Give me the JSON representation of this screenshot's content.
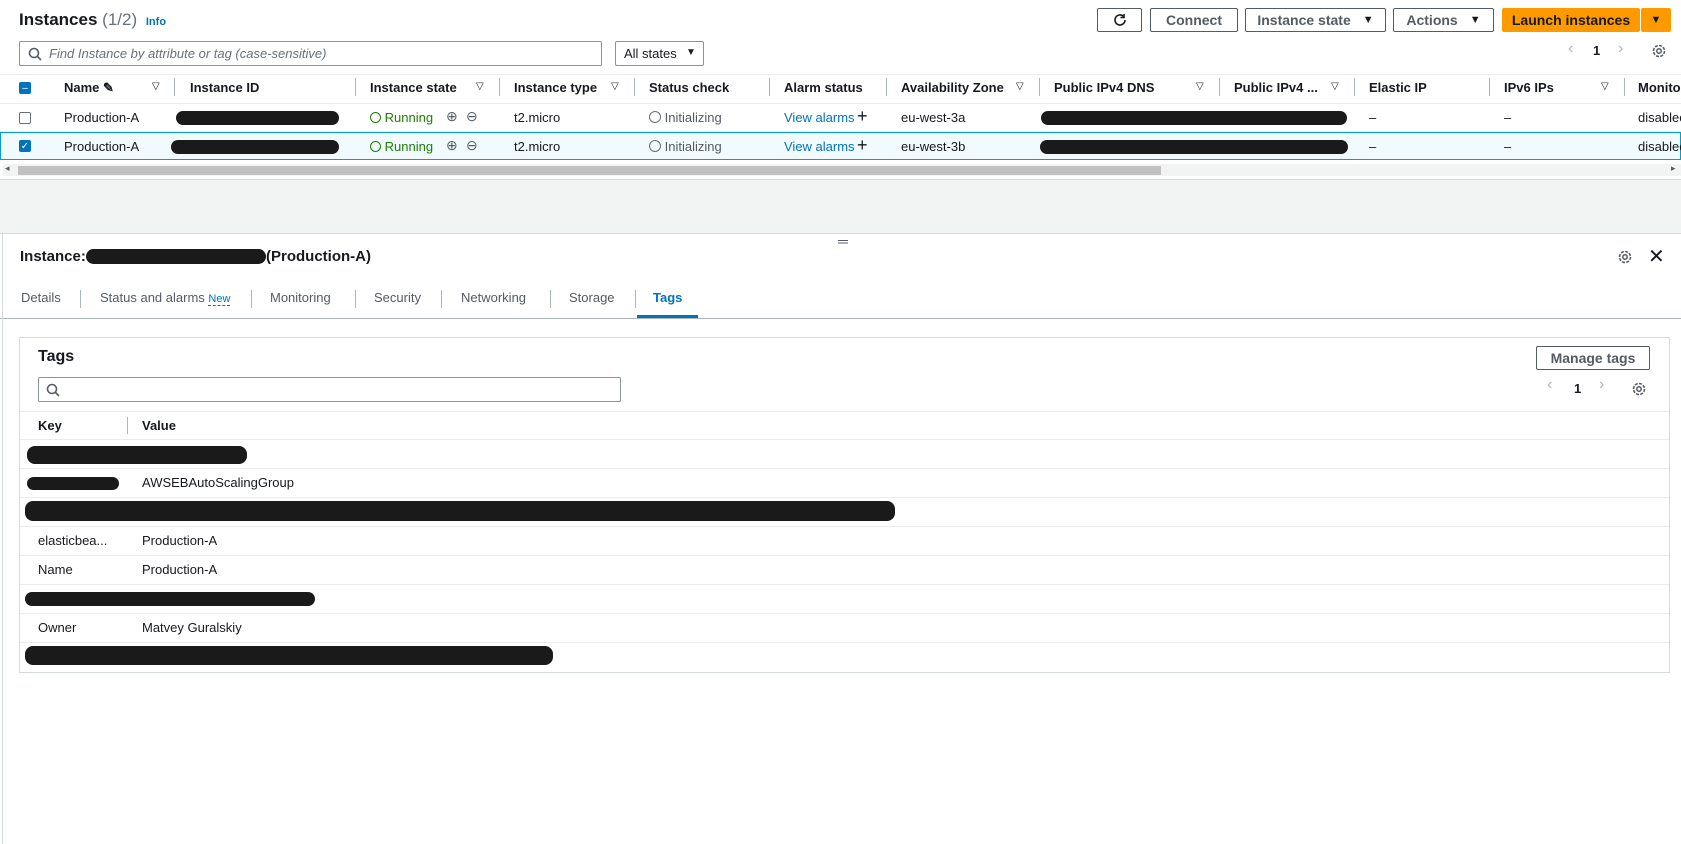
{
  "header": {
    "title": "Instances",
    "count": "(1/2)",
    "info": "Info",
    "refresh_icon": "refresh-icon",
    "connect": "Connect",
    "instance_state": "Instance state",
    "actions": "Actions",
    "launch": "Launch instances"
  },
  "search": {
    "placeholder": "Find Instance by attribute or tag (case-sensitive)",
    "filter_select": "All states"
  },
  "pagination": {
    "page": "1"
  },
  "table": {
    "columns": [
      "Name",
      "Instance ID",
      "Instance state",
      "Instance type",
      "Status check",
      "Alarm status",
      "Availability Zone",
      "Public IPv4 DNS",
      "Public IPv4 ...",
      "Elastic IP",
      "IPv6 IPs",
      "Monito"
    ],
    "rows": [
      {
        "name": "Production-A",
        "state": "Running",
        "type": "t2.micro",
        "status": "Initializing",
        "alarm": "View alarms",
        "az": "eu-west-3a",
        "eip": "–",
        "ipv6": "–",
        "monitoring": "disablec",
        "selected": false
      },
      {
        "name": "Production-A",
        "state": "Running",
        "type": "t2.micro",
        "status": "Initializing",
        "alarm": "View alarms",
        "az": "eu-west-3b",
        "eip": "–",
        "ipv6": "–",
        "monitoring": "disablec",
        "selected": true
      }
    ]
  },
  "details": {
    "title_prefix": "Instance:",
    "title_suffix": "(Production-A)",
    "tabs": [
      "Details",
      "Status and alarms",
      "Monitoring",
      "Security",
      "Networking",
      "Storage",
      "Tags"
    ],
    "new_badge": "New",
    "active_tab": "Tags"
  },
  "tags": {
    "heading": "Tags",
    "manage": "Manage tags",
    "page": "1",
    "key_header": "Key",
    "value_header": "Value",
    "rows": [
      {
        "key": "",
        "value": ""
      },
      {
        "key": "",
        "value": "AWSEBAutoScalingGroup"
      },
      {
        "key": "",
        "value": ""
      },
      {
        "key": "elasticbea...",
        "value": "Production-A"
      },
      {
        "key": "Name",
        "value": "Production-A"
      },
      {
        "key": "",
        "value": ""
      },
      {
        "key": "Owner",
        "value": "Matvey Guralskiy"
      },
      {
        "key": "",
        "value": ""
      }
    ]
  },
  "colors": {
    "accent": "#0073bb",
    "launch": "#ff9900",
    "running": "#1d8102"
  }
}
